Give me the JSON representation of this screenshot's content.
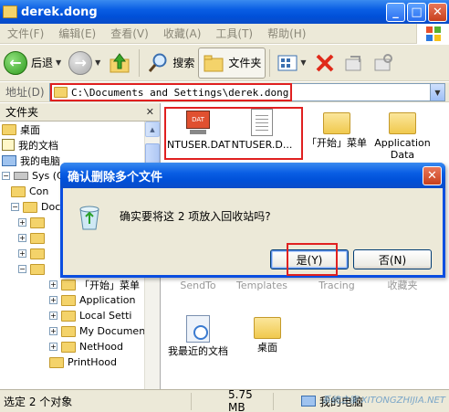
{
  "window": {
    "title": "derek.dong",
    "min": "_",
    "max": "□",
    "close": "✕"
  },
  "menu": [
    "文件(F)",
    "编辑(E)",
    "查看(V)",
    "收藏(A)",
    "工具(T)",
    "帮助(H)"
  ],
  "toolbar": {
    "back_label": "后退",
    "search_label": "搜索",
    "folders_label": "文件夹"
  },
  "address": {
    "label": "地址(D)",
    "path": "C:\\Documents and Settings\\derek.dong"
  },
  "folders_pane": {
    "title": "文件夹",
    "close": "✕",
    "tree": [
      {
        "label": "桌面",
        "indent": 0,
        "icon": "desktop",
        "expander": ""
      },
      {
        "label": "我的文档",
        "indent": 0,
        "icon": "doc",
        "expander": ""
      },
      {
        "label": "我的电脑",
        "indent": 0,
        "icon": "pc",
        "expander": ""
      },
      {
        "label": "Sys (C",
        "indent": 1,
        "icon": "drive",
        "expander": "−"
      },
      {
        "label": "Con",
        "indent": 2,
        "icon": "folder",
        "expander": ""
      },
      {
        "label": "Doc",
        "indent": 2,
        "icon": "folder",
        "expander": "−"
      },
      {
        "label": "",
        "indent": 3,
        "icon": "folder",
        "expander": "+"
      },
      {
        "label": "",
        "indent": 3,
        "icon": "folder",
        "expander": "+"
      },
      {
        "label": "",
        "indent": 3,
        "icon": "folder",
        "expander": "+"
      },
      {
        "label": "",
        "indent": 3,
        "icon": "folder",
        "expander": "−"
      },
      {
        "label": "「开始」菜单",
        "indent": 4,
        "icon": "folder",
        "expander": "+"
      },
      {
        "label": "Application",
        "indent": 4,
        "icon": "folder",
        "expander": "+"
      },
      {
        "label": "Local Setti",
        "indent": 4,
        "icon": "folder",
        "expander": "+"
      },
      {
        "label": "My Document",
        "indent": 4,
        "icon": "folder",
        "expander": "+"
      },
      {
        "label": "NetHood",
        "indent": 4,
        "icon": "folder",
        "expander": "+"
      },
      {
        "label": "PrintHood",
        "indent": 4,
        "icon": "folder",
        "expander": ""
      }
    ]
  },
  "files": {
    "ntuser_dat": "NTUSER.DAT",
    "ntuser_d": "NTUSER.D...",
    "dat_badge": "DAT",
    "start_menu": "「开始」菜单",
    "app_data": "Application Data",
    "sendto": "SendTo",
    "templates": "Templates",
    "tracing": "Tracing",
    "favorites": "收藏夹",
    "recent": "我最近的文档",
    "desktop": "桌面"
  },
  "dialog": {
    "title": "确认删除多个文件",
    "message": "确实要将这 2 项放入回收站吗?",
    "yes": "是(Y)",
    "no": "否(N)",
    "close": "✕"
  },
  "status": {
    "selection": "选定 2 个对象",
    "size": "5.75 MB",
    "location": "我的电脑",
    "watermark": "系统之家 XITONGZHIJIA.NET"
  }
}
